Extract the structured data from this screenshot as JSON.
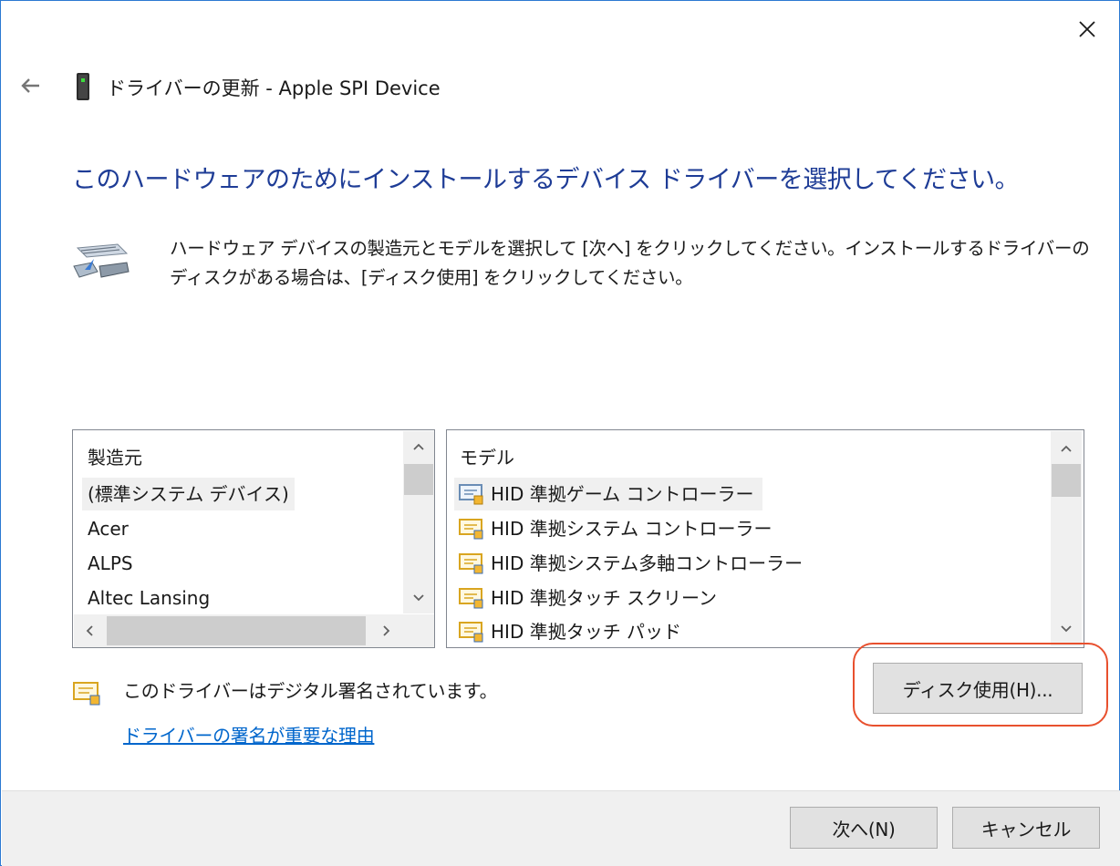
{
  "window": {
    "title": "ドライバーの更新 - Apple SPI Device",
    "back_icon": "arrow-left-icon",
    "close_icon": "close-icon",
    "device_icon": "device-icon"
  },
  "heading": "このハードウェアのためにインストールするデバイス ドライバーを選択してください。",
  "instruction": "ハードウェア デバイスの製造元とモデルを選択して [次へ] をクリックしてください。インストールするドライバーのディスクがある場合は、[ディスク使用] をクリックしてください。",
  "manufacturer_list": {
    "header": "製造元",
    "items": [
      "(標準システム デバイス)",
      "Acer",
      "ALPS",
      "Altec Lansing"
    ],
    "selected_index": 0
  },
  "model_list": {
    "header": "モデル",
    "items": [
      "HID 準拠ゲーム コントローラー",
      "HID 準拠システム コントローラー",
      "HID 準拠システム多軸コントローラー",
      "HID 準拠タッチ スクリーン",
      "HID 準拠タッチ パッド"
    ],
    "selected_index": 0
  },
  "signature": {
    "text": "このドライバーはデジタル署名されています。",
    "link": "ドライバーの署名が重要な理由"
  },
  "buttons": {
    "have_disk": "ディスク使用(H)...",
    "next": "次へ(N)",
    "cancel": "キャンセル"
  },
  "colors": {
    "heading": "#1e3c96",
    "link": "#0066cc",
    "highlight": "#e8502e",
    "border": "#2b79d2"
  }
}
